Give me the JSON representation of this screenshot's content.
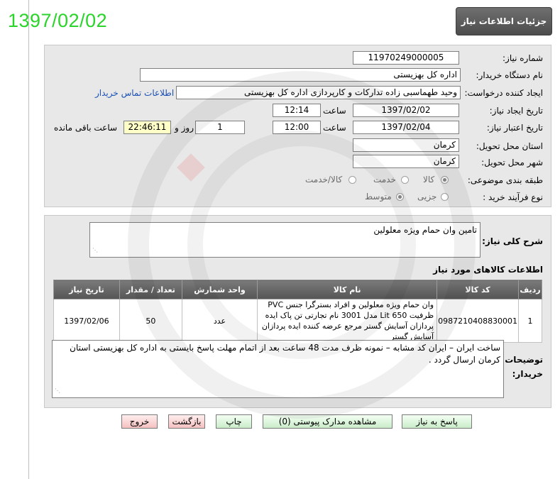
{
  "stamp_date": "1397/02/02",
  "header": {
    "title": "جزئیات اطلاعات نیاز"
  },
  "form": {
    "need_number_label": "شماره نیاز:",
    "need_number": "11970249000005",
    "buyer_org_label": "نام دستگاه خریدار:",
    "buyer_org": "اداره کل بهزیستی",
    "requester_label": "ایجاد کننده درخواست:",
    "requester": "وحید طهماسبی زاده تدارکات و کارپردازی اداره کل بهزیستی",
    "contact_link": "اطلاعات تماس خریدار",
    "created_label": "تاریخ ایجاد نیاز:",
    "created_date": "1397/02/02",
    "time_label": "ساعت",
    "created_time": "12:14",
    "validity_label": "تاریخ اعتبار نیاز:",
    "validity_date": "1397/02/04",
    "validity_time": "12:00",
    "days_value": "1",
    "days_and_label": "روز و",
    "remaining_time": "22:46:11",
    "remaining_label": "ساعت باقی مانده",
    "province_label": "استان محل تحویل:",
    "province": "کرمان",
    "city_label": "شهر محل تحویل:",
    "city": "کرمان",
    "category_label": "طبقه بندی موضوعی:",
    "category_options": [
      "کالا",
      "خدمت",
      "کالا/خدمت"
    ],
    "category_selected": "کالا",
    "process_label": "نوع فرآیند خرید :",
    "process_options": [
      "جزیی",
      "متوسط"
    ],
    "process_selected": "متوسط"
  },
  "general": {
    "label": "شرح کلی نیاز:",
    "text": "تامین وان حمام ویژه معلولین"
  },
  "items": {
    "section_title": "اطلاعات کالاهای مورد نیاز",
    "columns": [
      "ردیف",
      "کد کالا",
      "نام کالا",
      "واحد شمارش",
      "تعداد / مقدار",
      "تاریخ نیاز"
    ],
    "rows": [
      {
        "row": "1",
        "code": "0987210408830001",
        "name": "وان حمام ویژه معلولین و افراد بسترگرا جنس PVC ظرفیت 650 Lit مدل 3001 نام تجارتی تن پاک ایده پردازان آسایش گستر مرجع عرضه کننده ایده پردازان آسایش گستر",
        "unit": "عدد",
        "qty": "50",
        "date": "1397/02/06"
      }
    ]
  },
  "notes": {
    "label": "توضیحات خریدار:",
    "text": "ساخت ایران – ایران کد مشابه – نمونه ظرف مدت 48 ساعت بعد از اتمام مهلت پاسخ بایستی  به اداره کل بهزیستی استان کرمان  ارسال گردد ."
  },
  "buttons": {
    "reply": "پاسخ به نیاز",
    "attachments": "مشاهده مدارک پیوستی (0)",
    "print": "چاپ",
    "back": "بازگشت",
    "exit": "خروج"
  },
  "colors": {
    "stamp": "#2bd42b",
    "link": "#1a4fb5",
    "panel": "#e8e8e8",
    "highlight": "#ffffc8"
  }
}
